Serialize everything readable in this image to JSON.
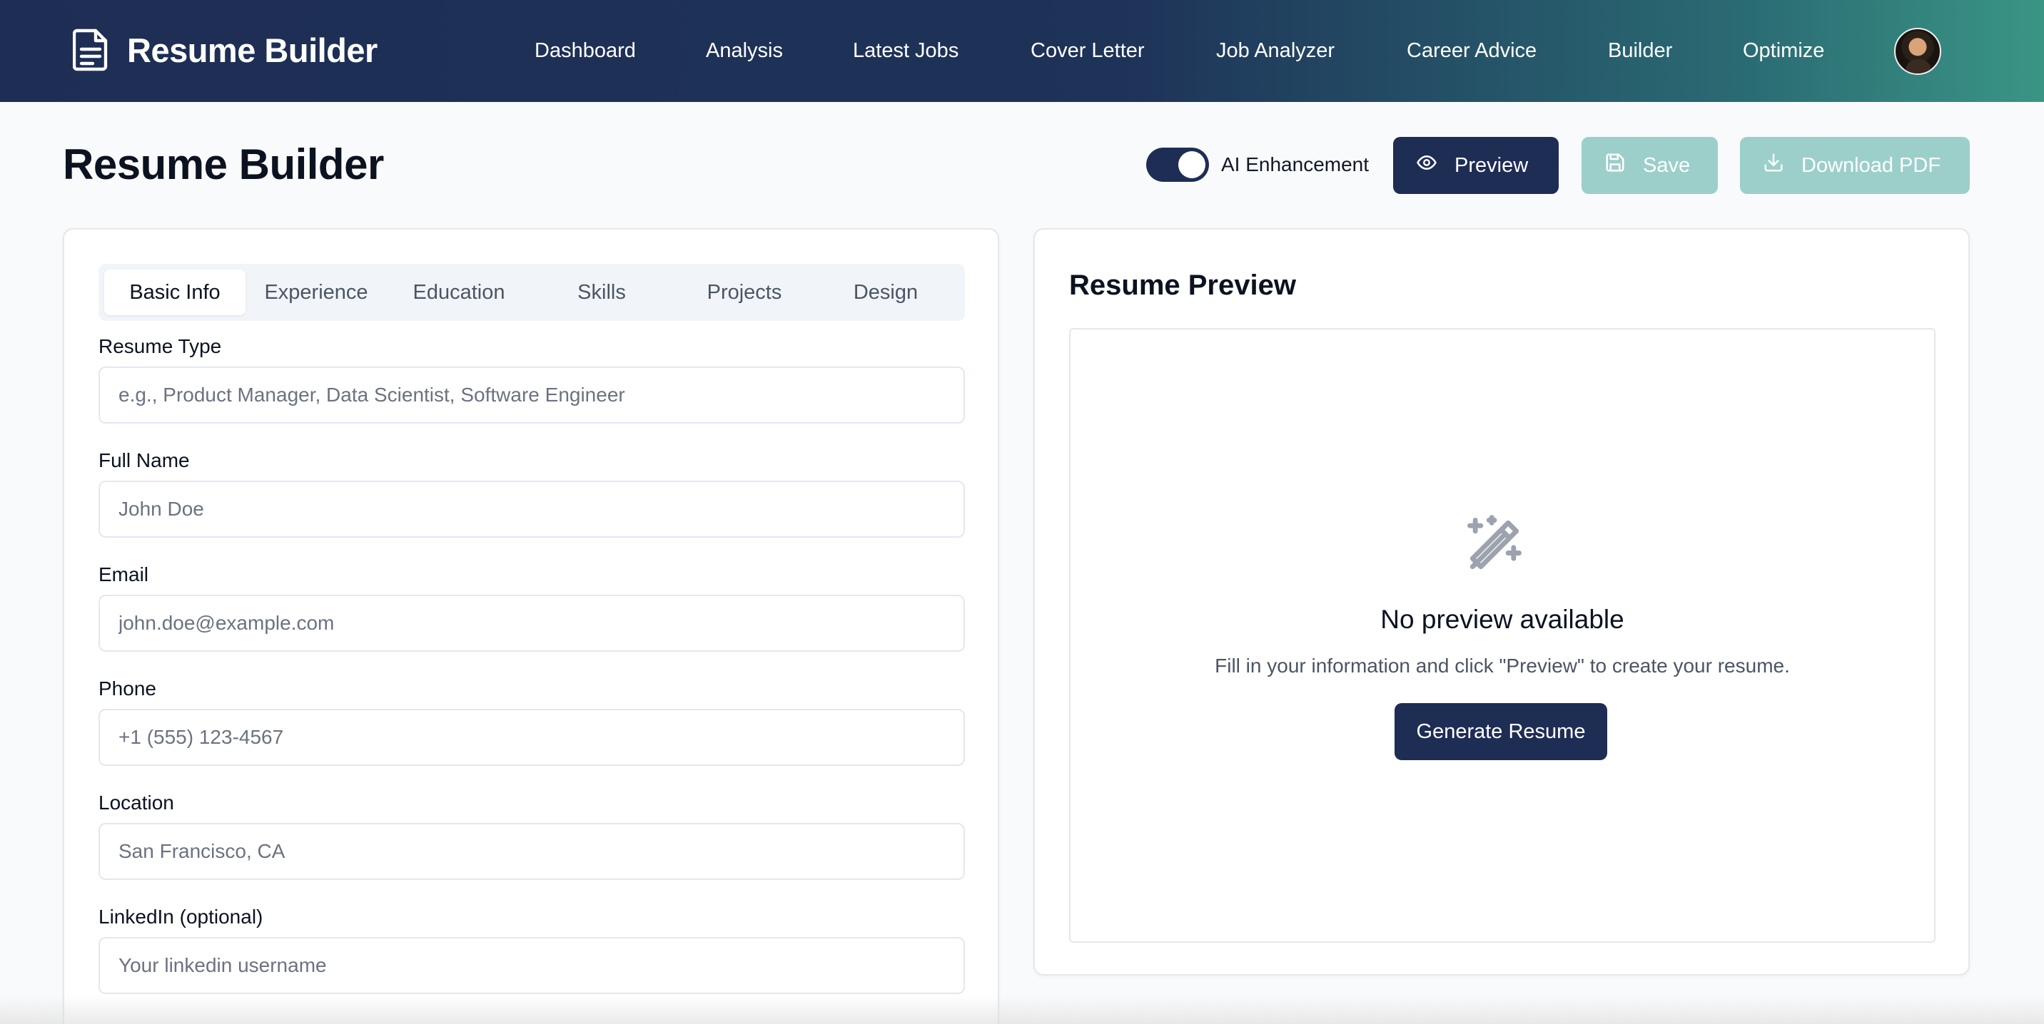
{
  "header": {
    "brand_title": "Resume Builder",
    "brand_icon": "document-icon",
    "nav": [
      {
        "label": "Dashboard"
      },
      {
        "label": "Analysis"
      },
      {
        "label": "Latest Jobs"
      },
      {
        "label": "Cover Letter"
      },
      {
        "label": "Job Analyzer"
      },
      {
        "label": "Career Advice"
      },
      {
        "label": "Builder"
      },
      {
        "label": "Optimize"
      }
    ],
    "gradient_start": "#1e2d54",
    "gradient_end": "#3a9585"
  },
  "toolbar": {
    "page_title": "Resume Builder",
    "ai_toggle_label": "AI Enhancement",
    "ai_toggle_on": true,
    "preview_label": "Preview",
    "save_label": "Save",
    "download_label": "Download PDF",
    "primary_color": "#1e2d54",
    "disabled_color": "#9ccfca"
  },
  "form": {
    "tabs": [
      {
        "label": "Basic Info",
        "active": true
      },
      {
        "label": "Experience"
      },
      {
        "label": "Education"
      },
      {
        "label": "Skills"
      },
      {
        "label": "Projects"
      },
      {
        "label": "Design"
      }
    ],
    "fields": [
      {
        "label": "Resume Type",
        "placeholder": "e.g., Product Manager, Data Scientist, Software Engineer"
      },
      {
        "label": "Full Name",
        "placeholder": "John Doe"
      },
      {
        "label": "Email",
        "placeholder": "john.doe@example.com"
      },
      {
        "label": "Phone",
        "placeholder": "+1 (555) 123-4567"
      },
      {
        "label": "Location",
        "placeholder": "San Francisco, CA"
      },
      {
        "label": "LinkedIn (optional)",
        "placeholder": "Your linkedin username"
      }
    ]
  },
  "preview": {
    "heading": "Resume Preview",
    "empty_icon": "magic-wand-icon",
    "empty_title": "No preview available",
    "empty_text": "Fill in your information and click \"Preview\" to create your resume.",
    "generate_label": "Generate Resume"
  }
}
